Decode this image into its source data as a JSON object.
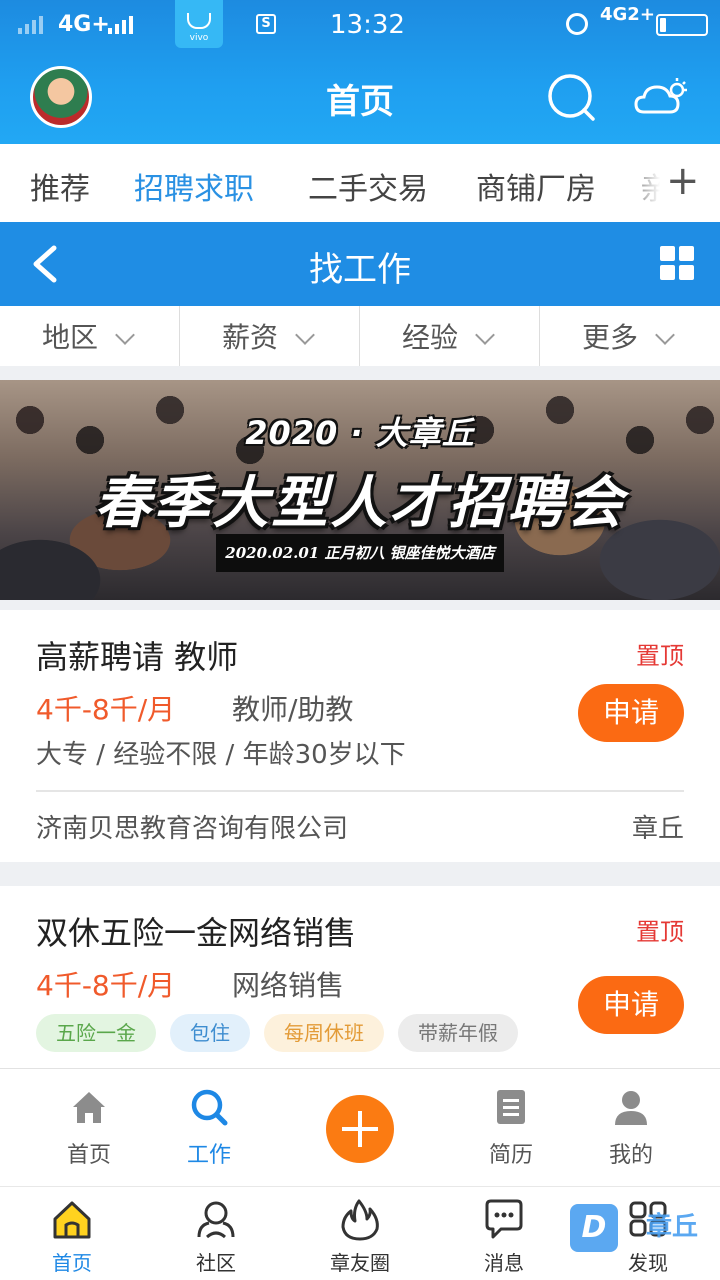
{
  "status_bar": {
    "network_left": "4G+",
    "vivo_badge": "vivo",
    "sim_icon": "S",
    "time": "13:32",
    "network_right": "4G2+"
  },
  "header": {
    "title": "首页"
  },
  "category_tabs": {
    "items": [
      "推荐",
      "招聘求职",
      "二手交易",
      "商铺厂房",
      "亲"
    ],
    "active_index": 1,
    "plus": "+"
  },
  "job_bar": {
    "title": "找工作"
  },
  "filters": [
    "地区",
    "薪资",
    "经验",
    "更多"
  ],
  "banner": {
    "year_line": "2020 · 大章丘",
    "headline": "春季大型人才招聘会",
    "subline": "2020.02.01 正月初八 银座佳悦大酒店"
  },
  "jobs": [
    {
      "title": "高薪聘请 教师",
      "pin": "置顶",
      "salary": "4千-8千/月",
      "category": "教师/助教",
      "requirements": "大专 / 经验不限 / 年龄30岁以下",
      "apply": "申请",
      "company": "济南贝思教育咨询有限公司",
      "location": "章丘"
    },
    {
      "title": "双休五险一金网络销售",
      "pin": "置顶",
      "salary": "4千-8千/月",
      "category": "网络销售",
      "apply": "申请",
      "tags": [
        "五险一金",
        "包住",
        "每周休班",
        "带薪年假"
      ]
    }
  ],
  "inner_nav": {
    "items": [
      {
        "label": "首页",
        "icon": "home-icon"
      },
      {
        "label": "工作",
        "icon": "search-icon"
      },
      {
        "label": "简历",
        "icon": "document-icon"
      },
      {
        "label": "我的",
        "icon": "user-icon"
      }
    ],
    "active_index": 1,
    "accent": "#fb7b12"
  },
  "outer_nav": {
    "items": [
      {
        "label": "首页",
        "icon": "home-icon"
      },
      {
        "label": "社区",
        "icon": "community-icon"
      },
      {
        "label": "章友圈",
        "icon": "fire-icon"
      },
      {
        "label": "消息",
        "icon": "message-icon"
      },
      {
        "label": "发现",
        "icon": "discover-icon"
      }
    ],
    "active_index": 0
  },
  "watermark": {
    "logo": "D",
    "text": "章丘"
  },
  "colors": {
    "brand_blue": "#1f8de4",
    "accent_orange": "#fb6a13",
    "pin_red": "#e53935",
    "salary_orange": "#f05a2b"
  }
}
